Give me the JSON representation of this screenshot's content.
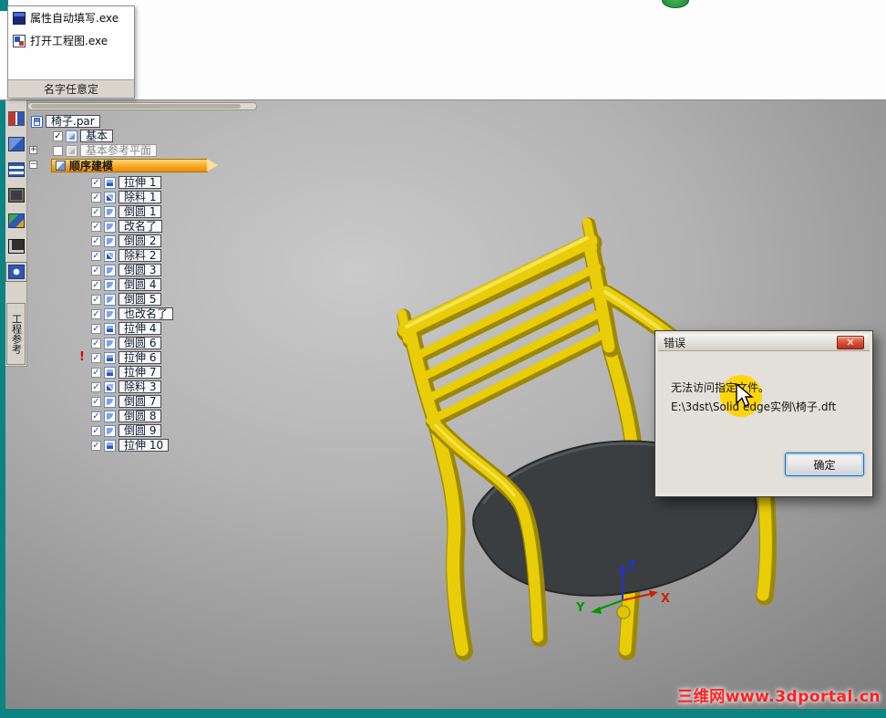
{
  "launcher": {
    "items": [
      {
        "label": "属性自动填写.exe",
        "icon": "app-window-icon"
      },
      {
        "label": "打开工程图.exe",
        "icon": "drawing-doc-icon"
      }
    ],
    "footer_label": "名字任意定"
  },
  "sidebar": {
    "icons": [
      "pathfinder-icon",
      "family-table-icon",
      "layers-icon",
      "sensors-icon",
      "playback-icon",
      "customize-icon",
      "engineering-reference-icon"
    ],
    "vertical_tab_label": "工程参考"
  },
  "tree": {
    "root": {
      "label": "椅子.par"
    },
    "nodes": [
      {
        "label": "基本",
        "checked": true
      },
      {
        "label": "基本参考平面",
        "checked": false,
        "grayed": true
      }
    ],
    "section_bar": {
      "label": "顺序建模"
    },
    "features": [
      {
        "label": "拉伸 1",
        "icon": "extrude"
      },
      {
        "label": "除料 1",
        "icon": "cutout"
      },
      {
        "label": "倒圆 1",
        "icon": "round"
      },
      {
        "label": "改名了",
        "icon": "round"
      },
      {
        "label": "倒圆 2",
        "icon": "round"
      },
      {
        "label": "除料 2",
        "icon": "cutout"
      },
      {
        "label": "倒圆 3",
        "icon": "round"
      },
      {
        "label": "倒圆 4",
        "icon": "round"
      },
      {
        "label": "倒圆 5",
        "icon": "round"
      },
      {
        "label": "也改名了",
        "icon": "round"
      },
      {
        "label": "拉伸 4",
        "icon": "extrude"
      },
      {
        "label": "倒圆 6",
        "icon": "round"
      },
      {
        "label": "拉伸 6",
        "icon": "extrude",
        "error": true
      },
      {
        "label": "拉伸 7",
        "icon": "extrude"
      },
      {
        "label": "除料 3",
        "icon": "cutout"
      },
      {
        "label": "倒圆 7",
        "icon": "round"
      },
      {
        "label": "倒圆 8",
        "icon": "round"
      },
      {
        "label": "倒圆 9",
        "icon": "round"
      },
      {
        "label": "拉伸 10",
        "icon": "extrude"
      }
    ],
    "error_mark": "!"
  },
  "dialog": {
    "title": "错误",
    "message_line1": "无法访问指定文件。",
    "message_line2": "E:\\3dst\\Solid edge实例\\椅子.dft",
    "ok_label": "确定"
  },
  "icons": {
    "check": "✓",
    "close": "✕",
    "plus": "+",
    "minus": "−"
  },
  "triad": {
    "x": "X",
    "y": "Y",
    "z": "Z"
  },
  "watermark": "三维网www.3dportal.cn",
  "colors": {
    "teal": "#0d8383",
    "orange": "#f6a31e",
    "yellow": "#e8cd08",
    "seat": "#3b3e40",
    "error-red": "#e00000",
    "watermark-red": "#ff2020"
  }
}
